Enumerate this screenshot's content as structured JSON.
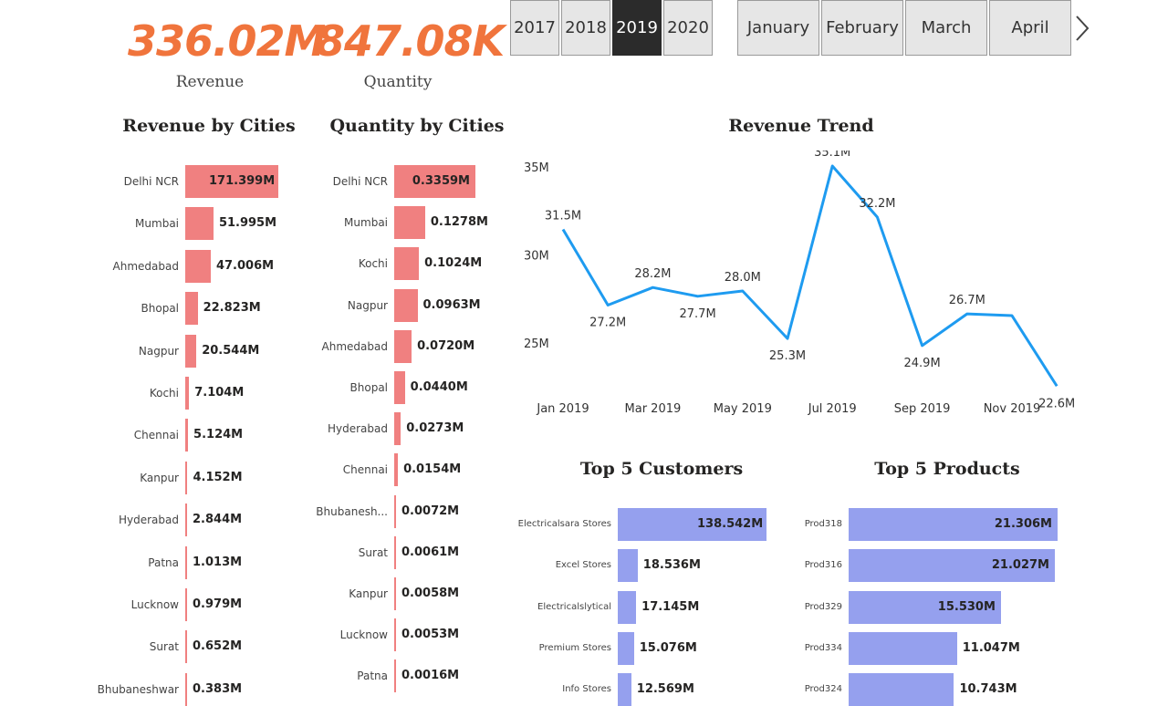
{
  "kpis": [
    {
      "value": "336.02M",
      "label": "Revenue",
      "color": "#f0743c"
    },
    {
      "value": "847.08K",
      "label": "Quantity",
      "color": "#f0743c"
    }
  ],
  "year_slicer": {
    "options": [
      "2017",
      "2018",
      "2019",
      "2020"
    ],
    "selected": "2019"
  },
  "month_slicer": {
    "options": [
      "January",
      "February",
      "March",
      "April"
    ],
    "next_icon": "chevron-right-icon"
  },
  "colors": {
    "city_bar": "#f08080",
    "top_bar": "#95a0ee",
    "trend_line": "#1e9bf0"
  },
  "chart_data": [
    {
      "type": "bar",
      "orientation": "horizontal",
      "title": "Revenue by Cities",
      "categories": [
        "Delhi NCR",
        "Mumbai",
        "Ahmedabad",
        "Bhopal",
        "Nagpur",
        "Kochi",
        "Chennai",
        "Kanpur",
        "Hyderabad",
        "Patna",
        "Lucknow",
        "Surat",
        "Bhubaneshwar"
      ],
      "values": [
        171.399,
        51.995,
        47.006,
        22.823,
        20.544,
        7.104,
        5.124,
        4.152,
        2.844,
        1.013,
        0.979,
        0.652,
        0.383
      ],
      "value_labels": [
        "171.399M",
        "51.995M",
        "47.006M",
        "22.823M",
        "20.544M",
        "7.104M",
        "5.124M",
        "4.152M",
        "2.844M",
        "1.013M",
        "0.979M",
        "0.652M",
        "0.383M"
      ],
      "max": 171.399
    },
    {
      "type": "bar",
      "orientation": "horizontal",
      "title": "Quantity by Cities",
      "categories": [
        "Delhi NCR",
        "Mumbai",
        "Kochi",
        "Nagpur",
        "Ahmedabad",
        "Bhopal",
        "Hyderabad",
        "Chennai",
        "Bhubanesh...",
        "Surat",
        "Kanpur",
        "Lucknow",
        "Patna"
      ],
      "values": [
        0.3359,
        0.1278,
        0.1024,
        0.0963,
        0.072,
        0.044,
        0.0273,
        0.0154,
        0.0072,
        0.0061,
        0.0058,
        0.0053,
        0.0016
      ],
      "value_labels": [
        "0.3359M",
        "0.1278M",
        "0.1024M",
        "0.0963M",
        "0.0720M",
        "0.0440M",
        "0.0273M",
        "0.0154M",
        "0.0072M",
        "0.0061M",
        "0.0058M",
        "0.0053M",
        "0.0016M"
      ],
      "max": 0.3359
    },
    {
      "type": "line",
      "title": "Revenue Trend",
      "x": [
        "Jan 2019",
        "Feb 2019",
        "Mar 2019",
        "Apr 2019",
        "May 2019",
        "Jun 2019",
        "Jul 2019",
        "Aug 2019",
        "Sep 2019",
        "Oct 2019",
        "Nov 2019",
        "Dec 2019"
      ],
      "x_tick_labels": [
        "Jan 2019",
        "Mar 2019",
        "May 2019",
        "Jul 2019",
        "Sep 2019",
        "Nov 2019"
      ],
      "values": [
        31.5,
        27.2,
        28.2,
        27.7,
        28.0,
        25.3,
        35.1,
        32.2,
        24.9,
        26.7,
        26.6,
        22.6
      ],
      "data_labels": [
        "31.5M",
        "27.2M",
        "28.2M",
        "27.7M",
        "28.0M",
        "25.3M",
        "35.1M",
        "32.2M",
        "24.9M",
        "26.7M",
        "",
        "22.6M"
      ],
      "y_ticks": [
        "35M",
        "30M",
        "25M"
      ],
      "y_tick_values": [
        35,
        30,
        25
      ],
      "ylim": [
        22.6,
        35.1
      ],
      "grid": false
    },
    {
      "type": "bar",
      "orientation": "horizontal",
      "title": "Top 5 Customers",
      "categories": [
        "Electricalsara Stores",
        "Excel Stores",
        "Electricalslytical",
        "Premium Stores",
        "Info Stores"
      ],
      "values": [
        138.542,
        18.536,
        17.145,
        15.076,
        12.569
      ],
      "value_labels": [
        "138.542M",
        "18.536M",
        "17.145M",
        "15.076M",
        "12.569M"
      ],
      "max": 138.542
    },
    {
      "type": "bar",
      "orientation": "horizontal",
      "title": "Top 5 Products",
      "categories": [
        "Prod318",
        "Prod316",
        "Prod329",
        "Prod334",
        "Prod324"
      ],
      "values": [
        21.306,
        21.027,
        15.53,
        11.047,
        10.743
      ],
      "value_labels": [
        "21.306M",
        "21.027M",
        "15.530M",
        "11.047M",
        "10.743M"
      ],
      "max": 21.306
    }
  ]
}
